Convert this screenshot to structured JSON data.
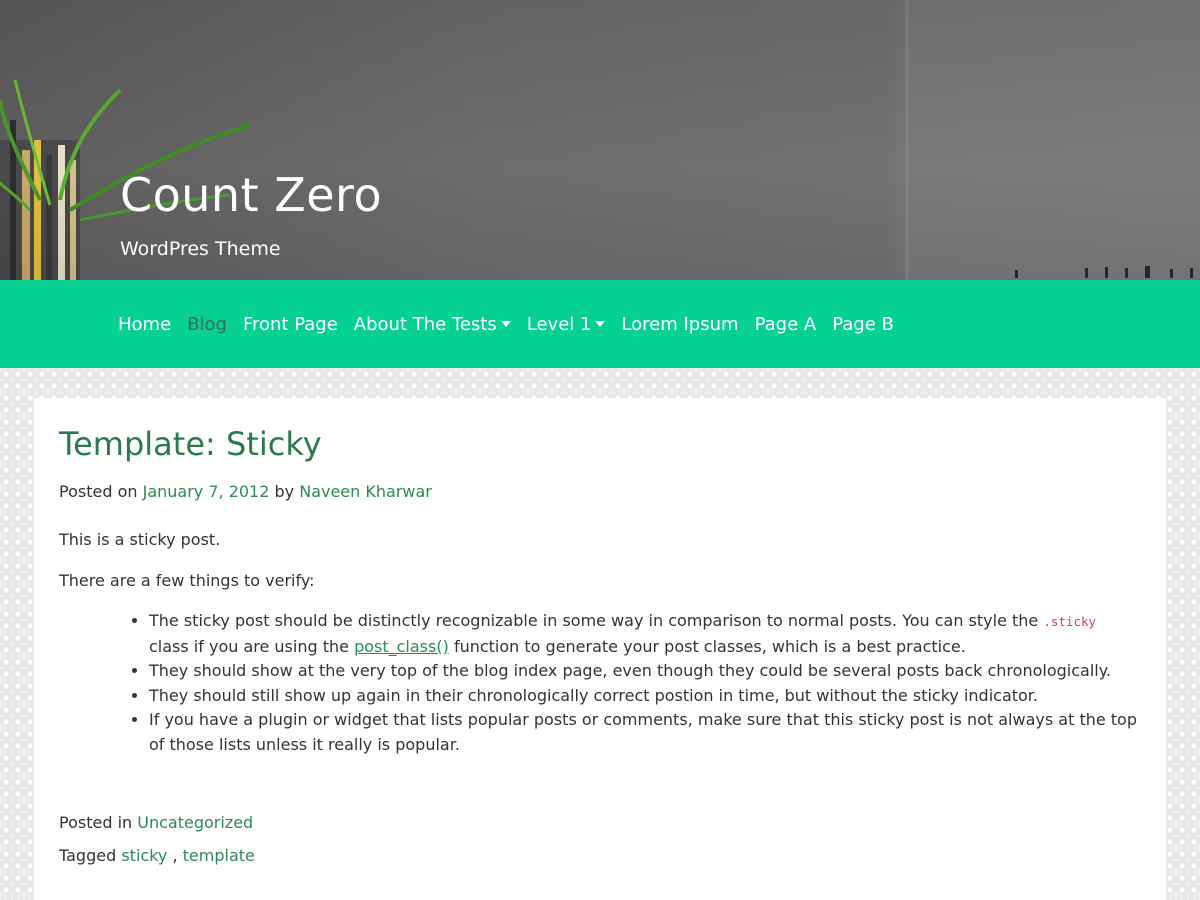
{
  "header": {
    "site_title": "Count Zero",
    "tagline": "WordPres Theme"
  },
  "nav": {
    "items": [
      {
        "label": "Home",
        "active": false,
        "dropdown": false
      },
      {
        "label": "Blog",
        "active": true,
        "dropdown": false
      },
      {
        "label": "Front Page",
        "active": false,
        "dropdown": false
      },
      {
        "label": "About The Tests",
        "active": false,
        "dropdown": true
      },
      {
        "label": "Level 1",
        "active": false,
        "dropdown": true
      },
      {
        "label": "Lorem Ipsum",
        "active": false,
        "dropdown": false
      },
      {
        "label": "Page A",
        "active": false,
        "dropdown": false
      },
      {
        "label": "Page B",
        "active": false,
        "dropdown": false
      }
    ]
  },
  "post": {
    "title": "Template: Sticky",
    "meta": {
      "posted_on_label": "Posted on",
      "date": "January 7, 2012",
      "by_label": "by",
      "author": "Naveen Kharwar"
    },
    "intro": "This is a sticky post.",
    "verify_intro": "There are a few things to verify:",
    "list": {
      "item1_part1": "The sticky post should be distinctly recognizable in some way in comparison to normal posts. You can style the",
      "item1_code": ".sticky",
      "item1_part2": "class if you are using the",
      "item1_link": "post_class()",
      "item1_part3": "function to generate your post classes, which is a best practice.",
      "item2": "They should show at the very top of the blog index page, even though they could be several posts back chronologically.",
      "item3": "They should still show up again in their chronologically correct postion in time, but without the sticky indicator.",
      "item4": "If you have a plugin or widget that lists popular posts or comments, make sure that this sticky post is not always at the top of those lists unless it really is popular."
    },
    "footer": {
      "posted_in_label": "Posted in",
      "category": "Uncategorized",
      "tagged_label": "Tagged",
      "tags": [
        "sticky",
        "template"
      ],
      "tag_separator": ","
    }
  },
  "colors": {
    "nav_bg": "#07d192",
    "title_green": "#2b7a4e",
    "link_green": "#2c8a55",
    "active_nav": "#3a6e5a",
    "code_pink": "#d63384"
  }
}
